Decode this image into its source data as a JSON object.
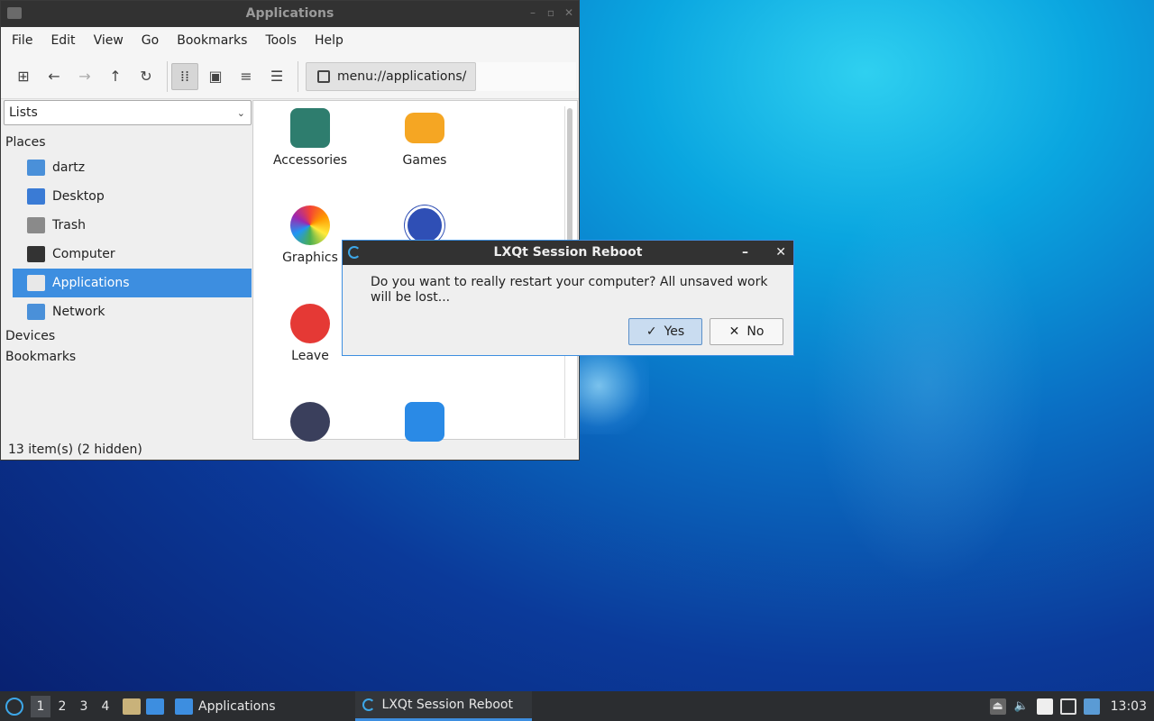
{
  "file_manager": {
    "window_title": "Applications",
    "menu": [
      "File",
      "Edit",
      "View",
      "Go",
      "Bookmarks",
      "Tools",
      "Help"
    ],
    "location": "menu://applications/",
    "side_select": "Lists",
    "sections": {
      "places": "Places",
      "devices": "Devices",
      "bookmarks": "Bookmarks"
    },
    "places": [
      "dartz",
      "Desktop",
      "Trash",
      "Computer",
      "Applications",
      "Network"
    ],
    "apps": [
      "Accessories",
      "Games",
      "Graphics",
      "Leave"
    ],
    "status": "13 item(s) (2 hidden)"
  },
  "dialog": {
    "title": "LXQt Session Reboot",
    "message": "Do you want to really restart your computer? All unsaved work will be lost...",
    "yes_label": "Yes",
    "no_label": "No"
  },
  "panel": {
    "desktops": [
      "1",
      "2",
      "3",
      "4"
    ],
    "tasks": [
      "Applications",
      "LXQt Session Reboot"
    ],
    "clock": "13:03"
  },
  "colors": {
    "accent": "#3d8ee0",
    "titlebar": "#323232",
    "panel": "#2b2d30"
  }
}
